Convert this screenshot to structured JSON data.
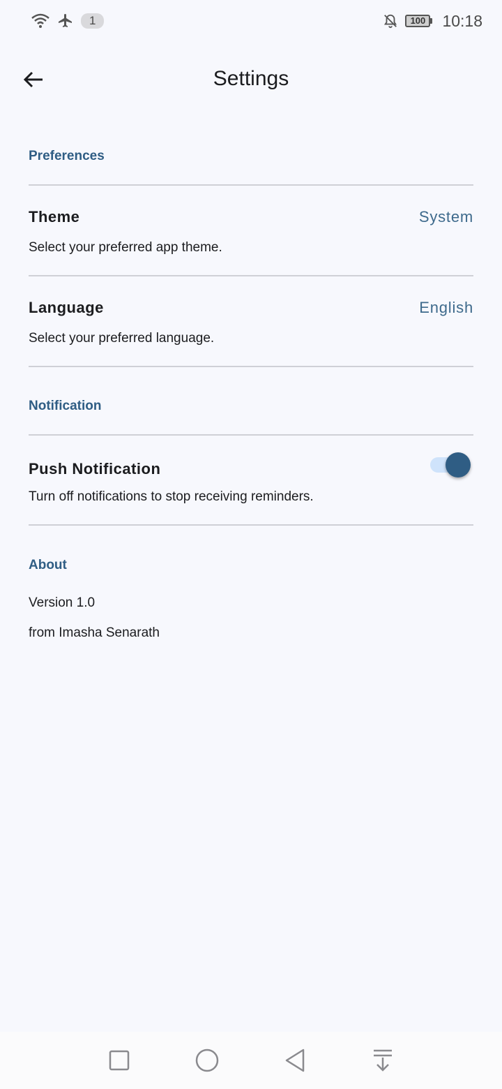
{
  "status_bar": {
    "icons_left": [
      "wifi-icon",
      "airplane-icon"
    ],
    "notification_count": "1",
    "icons_right": [
      "bell-off-icon"
    ],
    "battery": "100",
    "time": "10:18"
  },
  "app_bar": {
    "back_icon": "arrow-left-icon",
    "title": "Settings"
  },
  "sections": {
    "preferences": {
      "header": "Preferences",
      "theme": {
        "title": "Theme",
        "description": "Select your preferred app theme.",
        "value": "System"
      },
      "language": {
        "title": "Language",
        "description": "Select your preferred language.",
        "value": "English"
      }
    },
    "notification": {
      "header": "Notification",
      "push": {
        "title": "Push Notification",
        "description": "Turn off notifications to stop receiving reminders.",
        "enabled": true
      }
    },
    "about": {
      "header": "About",
      "version": "Version 1.0",
      "author": "from Imasha Senarath"
    }
  },
  "nav_bar": {
    "buttons": [
      "recents-square-icon",
      "home-circle-icon",
      "back-triangle-icon",
      "notification-pull-icon"
    ]
  },
  "colors": {
    "accent": "#2f5d84",
    "value_text": "#3e6a8c",
    "background": "#f7f8fd",
    "divider": "#cfd0d6",
    "toggle_track": "#cfe3fb"
  }
}
